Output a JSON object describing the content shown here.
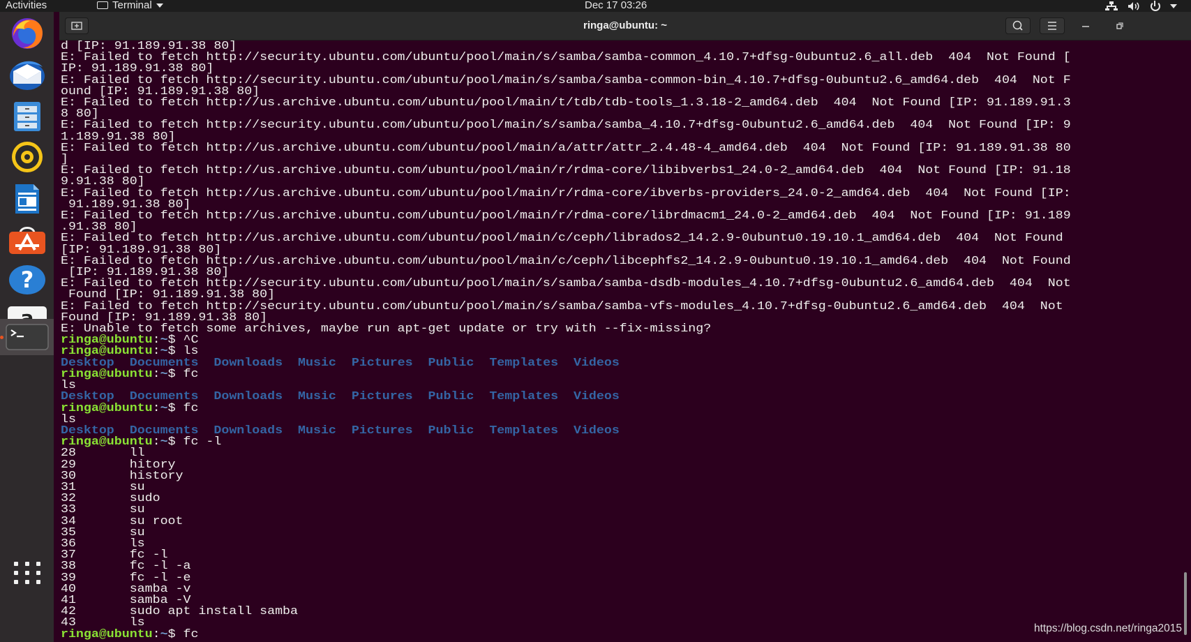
{
  "topbar": {
    "activities": "Activities",
    "app_name": "Terminal",
    "clock": "Dec 17  03:26"
  },
  "dock": {
    "items": [
      {
        "name": "Firefox"
      },
      {
        "name": "Thunderbird"
      },
      {
        "name": "Files"
      },
      {
        "name": "Rhythmbox"
      },
      {
        "name": "LibreOffice Writer"
      },
      {
        "name": "Ubuntu Software"
      },
      {
        "name": "Help"
      },
      {
        "name": "Amazon"
      },
      {
        "name": "Terminal",
        "active": true
      }
    ],
    "show_apps": "Show Applications"
  },
  "window": {
    "title": "ringa@ubuntu: ~"
  },
  "terminal": {
    "prompt_user": "ringa@ubuntu",
    "prompt_path": "~",
    "dirs": [
      "Desktop",
      "Documents",
      "Downloads",
      "Music",
      "Pictures",
      "Public",
      "Templates",
      "Videos"
    ],
    "lines": [
      {
        "t": "text",
        "s": "d [IP: 91.189.91.38 80]"
      },
      {
        "t": "text",
        "s": "E: Failed to fetch http://security.ubuntu.com/ubuntu/pool/main/s/samba/samba-common_4.10.7+dfsg-0ubuntu2.6_all.deb  404  Not Found ["
      },
      {
        "t": "text",
        "s": "IP: 91.189.91.38 80]"
      },
      {
        "t": "text",
        "s": "E: Failed to fetch http://security.ubuntu.com/ubuntu/pool/main/s/samba/samba-common-bin_4.10.7+dfsg-0ubuntu2.6_amd64.deb  404  Not F"
      },
      {
        "t": "text",
        "s": "ound [IP: 91.189.91.38 80]"
      },
      {
        "t": "text",
        "s": "E: Failed to fetch http://us.archive.ubuntu.com/ubuntu/pool/main/t/tdb/tdb-tools_1.3.18-2_amd64.deb  404  Not Found [IP: 91.189.91.3"
      },
      {
        "t": "text",
        "s": "8 80]"
      },
      {
        "t": "text",
        "s": "E: Failed to fetch http://security.ubuntu.com/ubuntu/pool/main/s/samba/samba_4.10.7+dfsg-0ubuntu2.6_amd64.deb  404  Not Found [IP: 9"
      },
      {
        "t": "text",
        "s": "1.189.91.38 80]"
      },
      {
        "t": "text",
        "s": "E: Failed to fetch http://us.archive.ubuntu.com/ubuntu/pool/main/a/attr/attr_2.4.48-4_amd64.deb  404  Not Found [IP: 91.189.91.38 80"
      },
      {
        "t": "text",
        "s": "]"
      },
      {
        "t": "text",
        "s": "E: Failed to fetch http://us.archive.ubuntu.com/ubuntu/pool/main/r/rdma-core/libibverbs1_24.0-2_amd64.deb  404  Not Found [IP: 91.18"
      },
      {
        "t": "text",
        "s": "9.91.38 80]"
      },
      {
        "t": "text",
        "s": "E: Failed to fetch http://us.archive.ubuntu.com/ubuntu/pool/main/r/rdma-core/ibverbs-providers_24.0-2_amd64.deb  404  Not Found [IP:"
      },
      {
        "t": "text",
        "s": " 91.189.91.38 80]"
      },
      {
        "t": "text",
        "s": "E: Failed to fetch http://us.archive.ubuntu.com/ubuntu/pool/main/r/rdma-core/librdmacm1_24.0-2_amd64.deb  404  Not Found [IP: 91.189"
      },
      {
        "t": "text",
        "s": ".91.38 80]"
      },
      {
        "t": "text",
        "s": "E: Failed to fetch http://us.archive.ubuntu.com/ubuntu/pool/main/c/ceph/librados2_14.2.9-0ubuntu0.19.10.1_amd64.deb  404  Not Found"
      },
      {
        "t": "text",
        "s": "[IP: 91.189.91.38 80]"
      },
      {
        "t": "text",
        "s": "E: Failed to fetch http://us.archive.ubuntu.com/ubuntu/pool/main/c/ceph/libcephfs2_14.2.9-0ubuntu0.19.10.1_amd64.deb  404  Not Found"
      },
      {
        "t": "text",
        "s": " [IP: 91.189.91.38 80]"
      },
      {
        "t": "text",
        "s": "E: Failed to fetch http://security.ubuntu.com/ubuntu/pool/main/s/samba/samba-dsdb-modules_4.10.7+dfsg-0ubuntu2.6_amd64.deb  404  Not"
      },
      {
        "t": "text",
        "s": " Found [IP: 91.189.91.38 80]"
      },
      {
        "t": "text",
        "s": "E: Failed to fetch http://security.ubuntu.com/ubuntu/pool/main/s/samba/samba-vfs-modules_4.10.7+dfsg-0ubuntu2.6_amd64.deb  404  Not"
      },
      {
        "t": "text",
        "s": "Found [IP: 91.189.91.38 80]"
      },
      {
        "t": "text",
        "s": "E: Unable to fetch some archives, maybe run apt-get update or try with --fix-missing?"
      },
      {
        "t": "prompt",
        "s": "^C"
      },
      {
        "t": "prompt",
        "s": "ls"
      },
      {
        "t": "dirs"
      },
      {
        "t": "prompt",
        "s": "fc"
      },
      {
        "t": "text",
        "s": "ls"
      },
      {
        "t": "dirs"
      },
      {
        "t": "prompt",
        "s": "fc"
      },
      {
        "t": "text",
        "s": "ls"
      },
      {
        "t": "dirs"
      },
      {
        "t": "prompt",
        "s": "fc -l"
      },
      {
        "t": "text",
        "s": "28       ll"
      },
      {
        "t": "text",
        "s": "29       hitory"
      },
      {
        "t": "text",
        "s": "30       history"
      },
      {
        "t": "text",
        "s": "31       su"
      },
      {
        "t": "text",
        "s": "32       sudo"
      },
      {
        "t": "text",
        "s": "33       su"
      },
      {
        "t": "text",
        "s": "34       su root"
      },
      {
        "t": "text",
        "s": "35       su"
      },
      {
        "t": "text",
        "s": "36       ls"
      },
      {
        "t": "text",
        "s": "37       fc -l"
      },
      {
        "t": "text",
        "s": "38       fc -l -a"
      },
      {
        "t": "text",
        "s": "39       fc -l -e"
      },
      {
        "t": "text",
        "s": "40       samba -v"
      },
      {
        "t": "text",
        "s": "41       samba -V"
      },
      {
        "t": "text",
        "s": "42       sudo apt install samba"
      },
      {
        "t": "text",
        "s": "43       ls"
      },
      {
        "t": "prompt",
        "s": "fc"
      }
    ]
  },
  "watermark": "https://blog.csdn.net/ringa2015",
  "colors": {
    "terminal_bg": "#2c001e",
    "prompt": "#8ae234",
    "path": "#729fcf",
    "directory": "#3465a4",
    "accent": "#e95420",
    "dock_bg": "#2e2a2c",
    "topbar_bg": "#1d1d1d"
  }
}
